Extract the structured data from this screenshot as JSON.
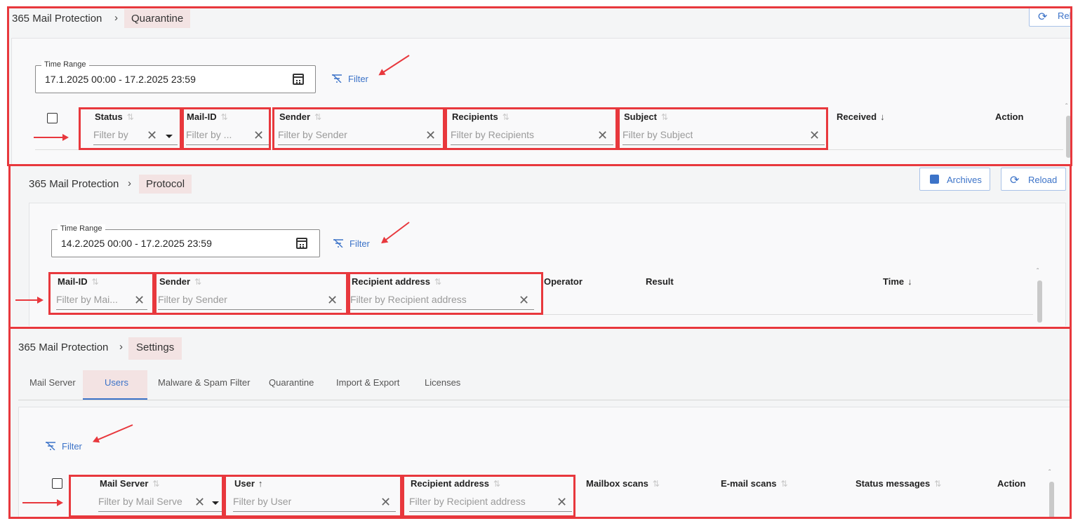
{
  "quarantine": {
    "breadcrumb_root": "365 Mail Protection",
    "breadcrumb_current": "Quarantine",
    "reload_label": "Reloa",
    "time_range_label": "Time Range",
    "time_range_value": "17.1.2025 00:00 - 17.2.2025 23:59",
    "filter_label": "Filter",
    "columns": {
      "status": "Status",
      "mail_id": "Mail-ID",
      "sender": "Sender",
      "recipients": "Recipients",
      "subject": "Subject",
      "received": "Received",
      "action": "Action"
    },
    "placeholders": {
      "status": "Filter by",
      "mail_id": "Filter by ...",
      "sender": "Filter by Sender",
      "recipients": "Filter by Recipients",
      "subject": "Filter by Subject"
    }
  },
  "protocol": {
    "breadcrumb_root": "365 Mail Protection",
    "breadcrumb_current": "Protocol",
    "archives_label": "Archives",
    "reload_label": "Reload",
    "time_range_label": "Time Range",
    "time_range_value": "14.2.2025 00:00 - 17.2.2025 23:59",
    "filter_label": "Filter",
    "columns": {
      "mail_id": "Mail-ID",
      "sender": "Sender",
      "recipient_address": "Recipient address",
      "operator": "Operator",
      "result": "Result",
      "time": "Time"
    },
    "placeholders": {
      "mail_id": "Filter by Mai...",
      "sender": "Filter by Sender",
      "recipient_address": "Filter by Recipient address"
    }
  },
  "settings": {
    "breadcrumb_root": "365 Mail Protection",
    "breadcrumb_current": "Settings",
    "tabs": [
      "Mail Server",
      "Users",
      "Malware & Spam Filter",
      "Quarantine",
      "Import & Export",
      "Licenses"
    ],
    "active_tab": "Users",
    "filter_label": "Filter",
    "columns": {
      "mail_server": "Mail Server",
      "user": "User",
      "recipient_address": "Recipient address",
      "mailbox_scans": "Mailbox scans",
      "email_scans": "E-mail scans",
      "status_messages": "Status messages",
      "action": "Action"
    },
    "placeholders": {
      "mail_server": "Filter by Mail Serve",
      "user": "Filter by User",
      "recipient_address": "Filter by Recipient address"
    }
  },
  "colors": {
    "highlight": "#e8383d",
    "accent": "#3c73c8",
    "current_crumb_bg": "#f3e3e3"
  },
  "icons": [
    "chevron-right-icon",
    "calendar-icon",
    "filter-off-icon",
    "clear-icon",
    "sort-icon",
    "sort-desc-icon",
    "sort-asc-icon",
    "reload-icon",
    "archive-icon",
    "dropdown-caret-icon"
  ]
}
